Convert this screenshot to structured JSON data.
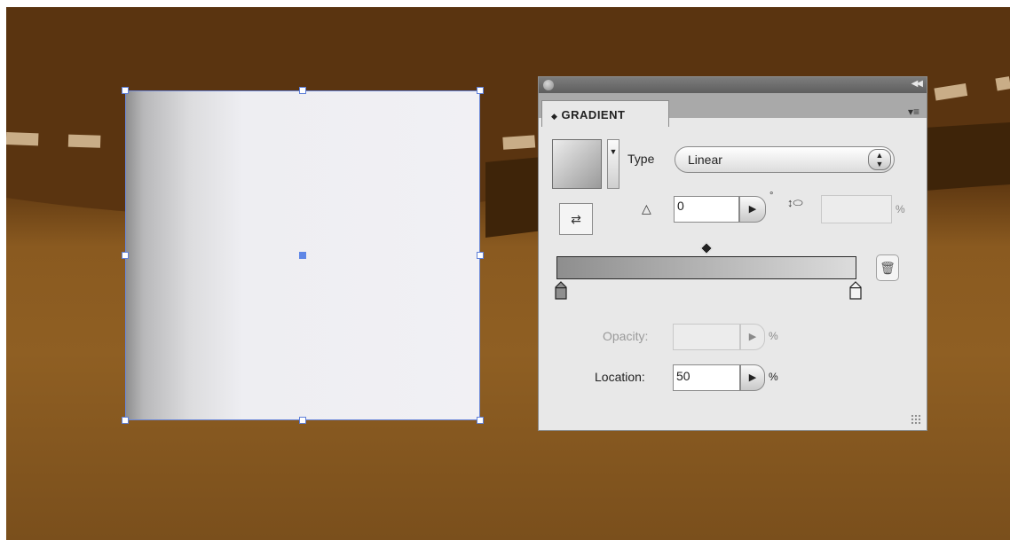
{
  "colors": {
    "canvas_dark": "#5b3510",
    "canvas_light": "#8f5f23",
    "selection": "#5f7fd8",
    "panel_bg": "#e8e8e8"
  },
  "panel": {
    "tab_label": "GRADIENT",
    "tab_icon": "double-chevron-icon",
    "menu_icon": "panel-menu-icon",
    "type_label": "Type",
    "type_value": "Linear",
    "angle_value": "0",
    "degree_symbol": "°",
    "aspect_unit": "%",
    "opacity_label": "Opacity:",
    "opacity_unit": "%",
    "location_label": "Location:",
    "location_value": "50",
    "location_unit": "%"
  }
}
